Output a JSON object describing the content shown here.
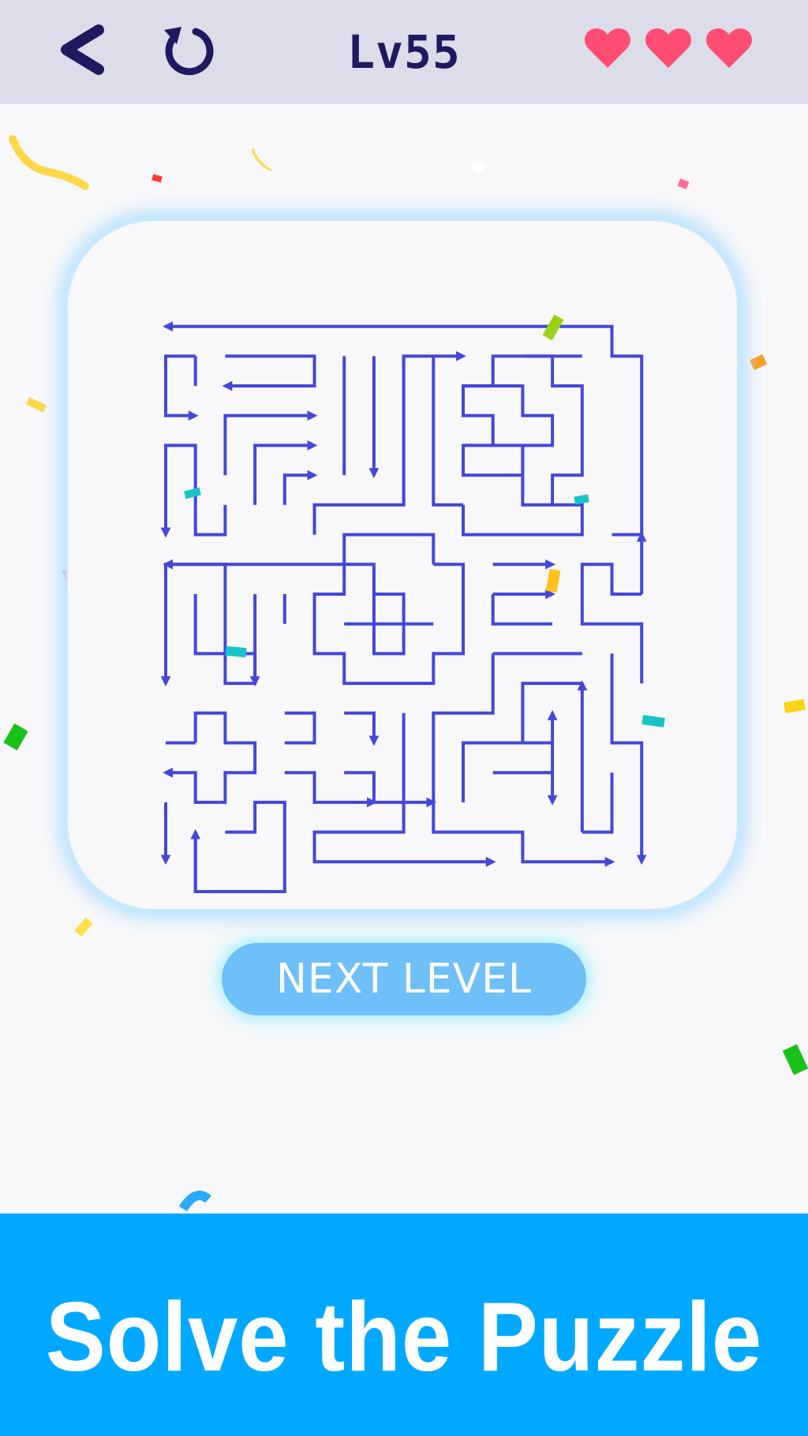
{
  "header": {
    "back_icon": "chevron-left-icon",
    "restart_icon": "restart-icon",
    "level": "Lv55",
    "lives": 3,
    "heart_icon": "heart-icon",
    "heart_color": "#ff4d73",
    "icon_color": "#1f1a60"
  },
  "maze": {
    "line_color": "#4447d8",
    "grid_size": 17
  },
  "next_level_label": "NEXT LEVEL",
  "banner": {
    "text": "Solve the Puzzle",
    "color": "#00a9ff"
  }
}
